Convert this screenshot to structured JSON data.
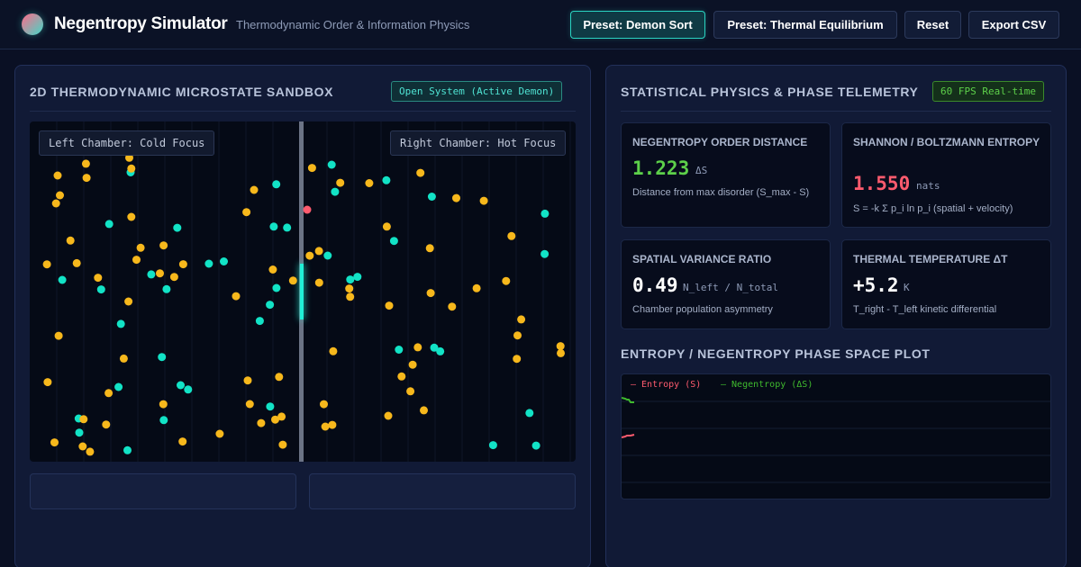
{
  "header": {
    "title": "Negentropy Simulator",
    "subtitle": "Thermodynamic Order & Information Physics",
    "buttons": {
      "demon_sort": "Preset: Demon Sort",
      "thermal": "Preset: Thermal Equilibrium",
      "reset": "Reset",
      "export": "Export CSV"
    }
  },
  "sandbox_panel": {
    "title": "2D THERMODYNAMIC MICROSTATE SANDBOX",
    "badge": "Open System (Active Demon)",
    "left_label": "Left Chamber: Cold Focus",
    "right_label": "Right Chamber: Hot Focus"
  },
  "telemetry_panel": {
    "title": "STATISTICAL PHYSICS & PHASE TELEMETRY",
    "badge": "60 FPS Real-time",
    "cards": [
      {
        "label": "NEGENTROPY ORDER DISTANCE",
        "value": "1.223",
        "unit": "ΔS",
        "desc": "Distance from max disorder (S_max - S)",
        "color": "#5dd04a"
      },
      {
        "label": "SHANNON / BOLTZMANN ENTROPY",
        "value": "1.550",
        "unit": "nats",
        "desc": "S = -k Σ p_i ln p_i (spatial + velocity)",
        "color": "#ff5b6e"
      },
      {
        "label": "SPATIAL VARIANCE RATIO",
        "value": "0.49",
        "unit": "N_left / N_total",
        "desc": "Chamber population asymmetry",
        "color": "#ffffff"
      },
      {
        "label": "THERMAL TEMPERATURE ΔT",
        "value": "+5.2",
        "unit": "K",
        "desc": "T_right - T_left kinetic differential",
        "color": "#ffffff"
      }
    ],
    "plot_title": "ENTROPY / NEGENTROPY PHASE SPACE PLOT",
    "legend": {
      "entropy": "— Entropy (S)",
      "negentropy": "— Negentropy (ΔS)"
    }
  },
  "colors": {
    "cold": "#12e3c6",
    "hot": "#f7b81c",
    "demon": "#ff5b6e",
    "accent": "#2ad4c2",
    "entropy": "#ff5b6e",
    "negentropy": "#3fb92e"
  },
  "particles": {
    "cold_count": 45,
    "hot_count": 80
  }
}
